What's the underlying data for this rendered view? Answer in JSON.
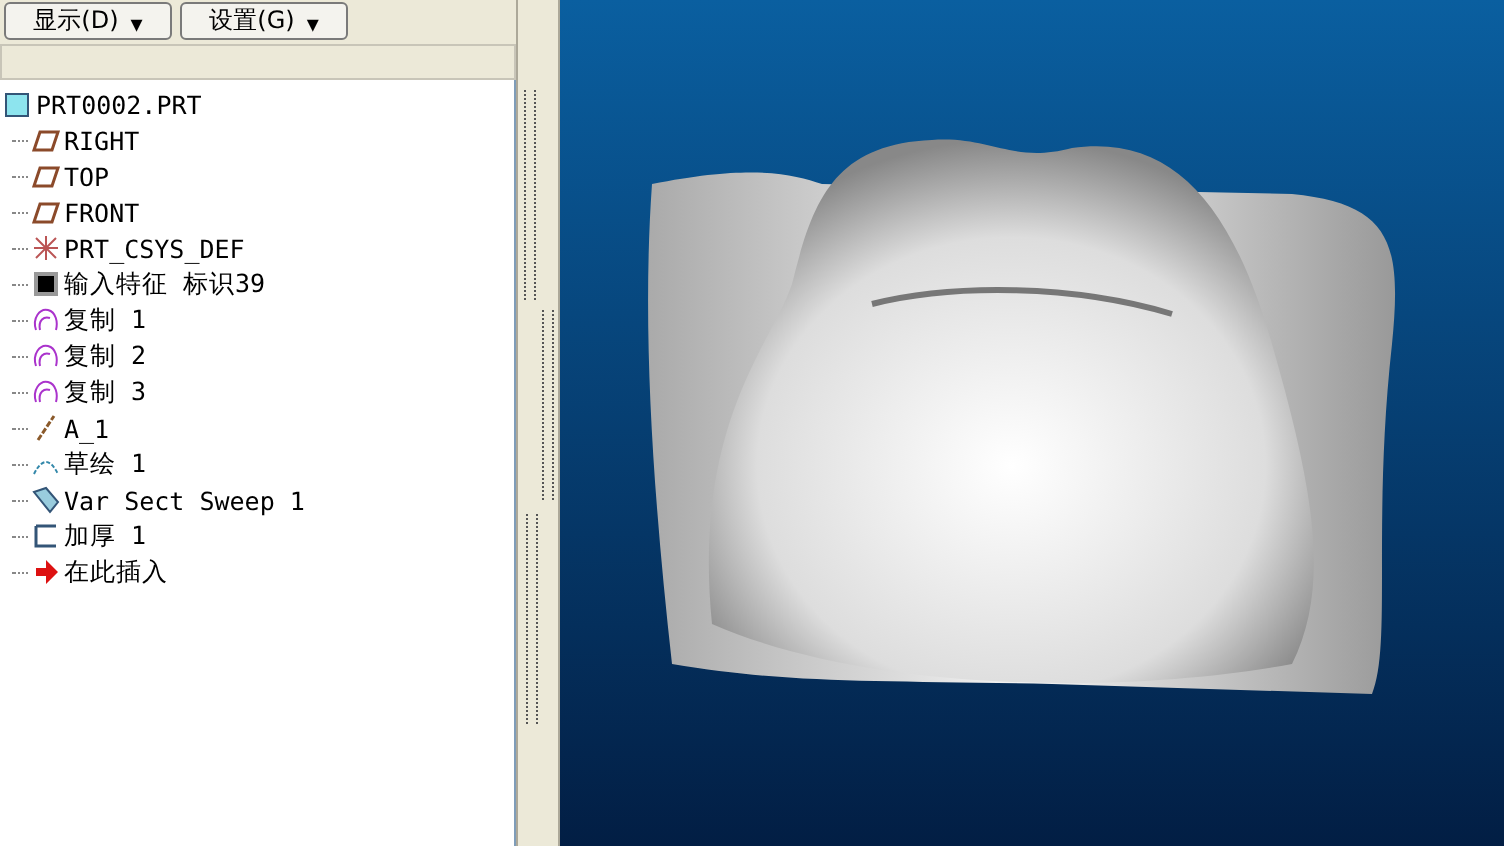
{
  "toolbar": {
    "buttons": [
      {
        "label": "显示(D)",
        "caret": "▾"
      },
      {
        "label": "设置(G)",
        "caret": "▾"
      }
    ]
  },
  "model_tree": {
    "root": {
      "label": "PRT0002.PRT",
      "kind": "part",
      "children": [
        {
          "label": "RIGHT",
          "kind": "plane"
        },
        {
          "label": "TOP",
          "kind": "plane"
        },
        {
          "label": "FRONT",
          "kind": "plane"
        },
        {
          "label": "PRT_CSYS_DEF",
          "kind": "csys"
        },
        {
          "label": "输入特征 标识39",
          "kind": "import"
        },
        {
          "label": "复制 1",
          "kind": "copy"
        },
        {
          "label": "复制 2",
          "kind": "copy"
        },
        {
          "label": "复制 3",
          "kind": "copy"
        },
        {
          "label": "A_1",
          "kind": "axis"
        },
        {
          "label": "草绘 1",
          "kind": "sketch"
        },
        {
          "label": "Var Sect Sweep 1",
          "kind": "sweep"
        },
        {
          "label": "加厚 1",
          "kind": "thicken"
        },
        {
          "label": "在此插入",
          "kind": "insert"
        }
      ]
    }
  }
}
